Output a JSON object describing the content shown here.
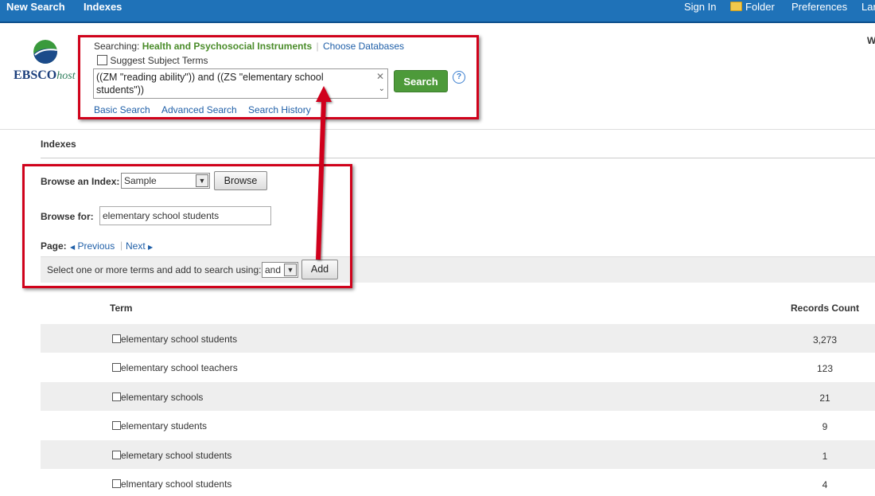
{
  "topbar": {
    "left_items": [
      "New Search",
      "Indexes"
    ],
    "right_items": [
      "Sign In",
      "Folder",
      "Preferences",
      "Lan"
    ]
  },
  "header": {
    "searching_label": "Searching:",
    "database": "Health and Psychosocial Instruments",
    "choose_databases": "Choose Databases",
    "suggest_terms": "Suggest Subject Terms",
    "query": "((ZM \"reading ability\"))  and  ((ZS \"elementary school students\"))",
    "search_button": "Search",
    "help": "?",
    "links": [
      "Basic Search",
      "Advanced Search",
      "Search History"
    ],
    "right_letter": "W"
  },
  "logo": {
    "text_main": "EBSCO",
    "text_sub": "host"
  },
  "indexes": {
    "heading": "Indexes",
    "browse_index_label": "Browse an Index:",
    "browse_index_value": "Sample",
    "browse_button": "Browse",
    "browse_for_label": "Browse for:",
    "browse_for_value": "elementary school students",
    "page_label": "Page:",
    "previous": "Previous",
    "next": "Next",
    "select_instruction": "Select one or more terms and add to search using:",
    "operator_value": "and",
    "add_button": "Add"
  },
  "table": {
    "headers": {
      "term": "Term",
      "records_count": "Records Count"
    },
    "rows": [
      {
        "term": "elementary school students",
        "count": "3,273"
      },
      {
        "term": "elementary school teachers",
        "count": "123"
      },
      {
        "term": "elementary schools",
        "count": "21"
      },
      {
        "term": "elementary students",
        "count": "9"
      },
      {
        "term": "elemetary school students",
        "count": "1"
      },
      {
        "term": "elmentary school students",
        "count": "4"
      }
    ]
  },
  "colors": {
    "topbar": "#1f72b8",
    "highlight": "#d0021b",
    "search_button": "#4d9a3a",
    "database_text": "#4a8c2a"
  }
}
